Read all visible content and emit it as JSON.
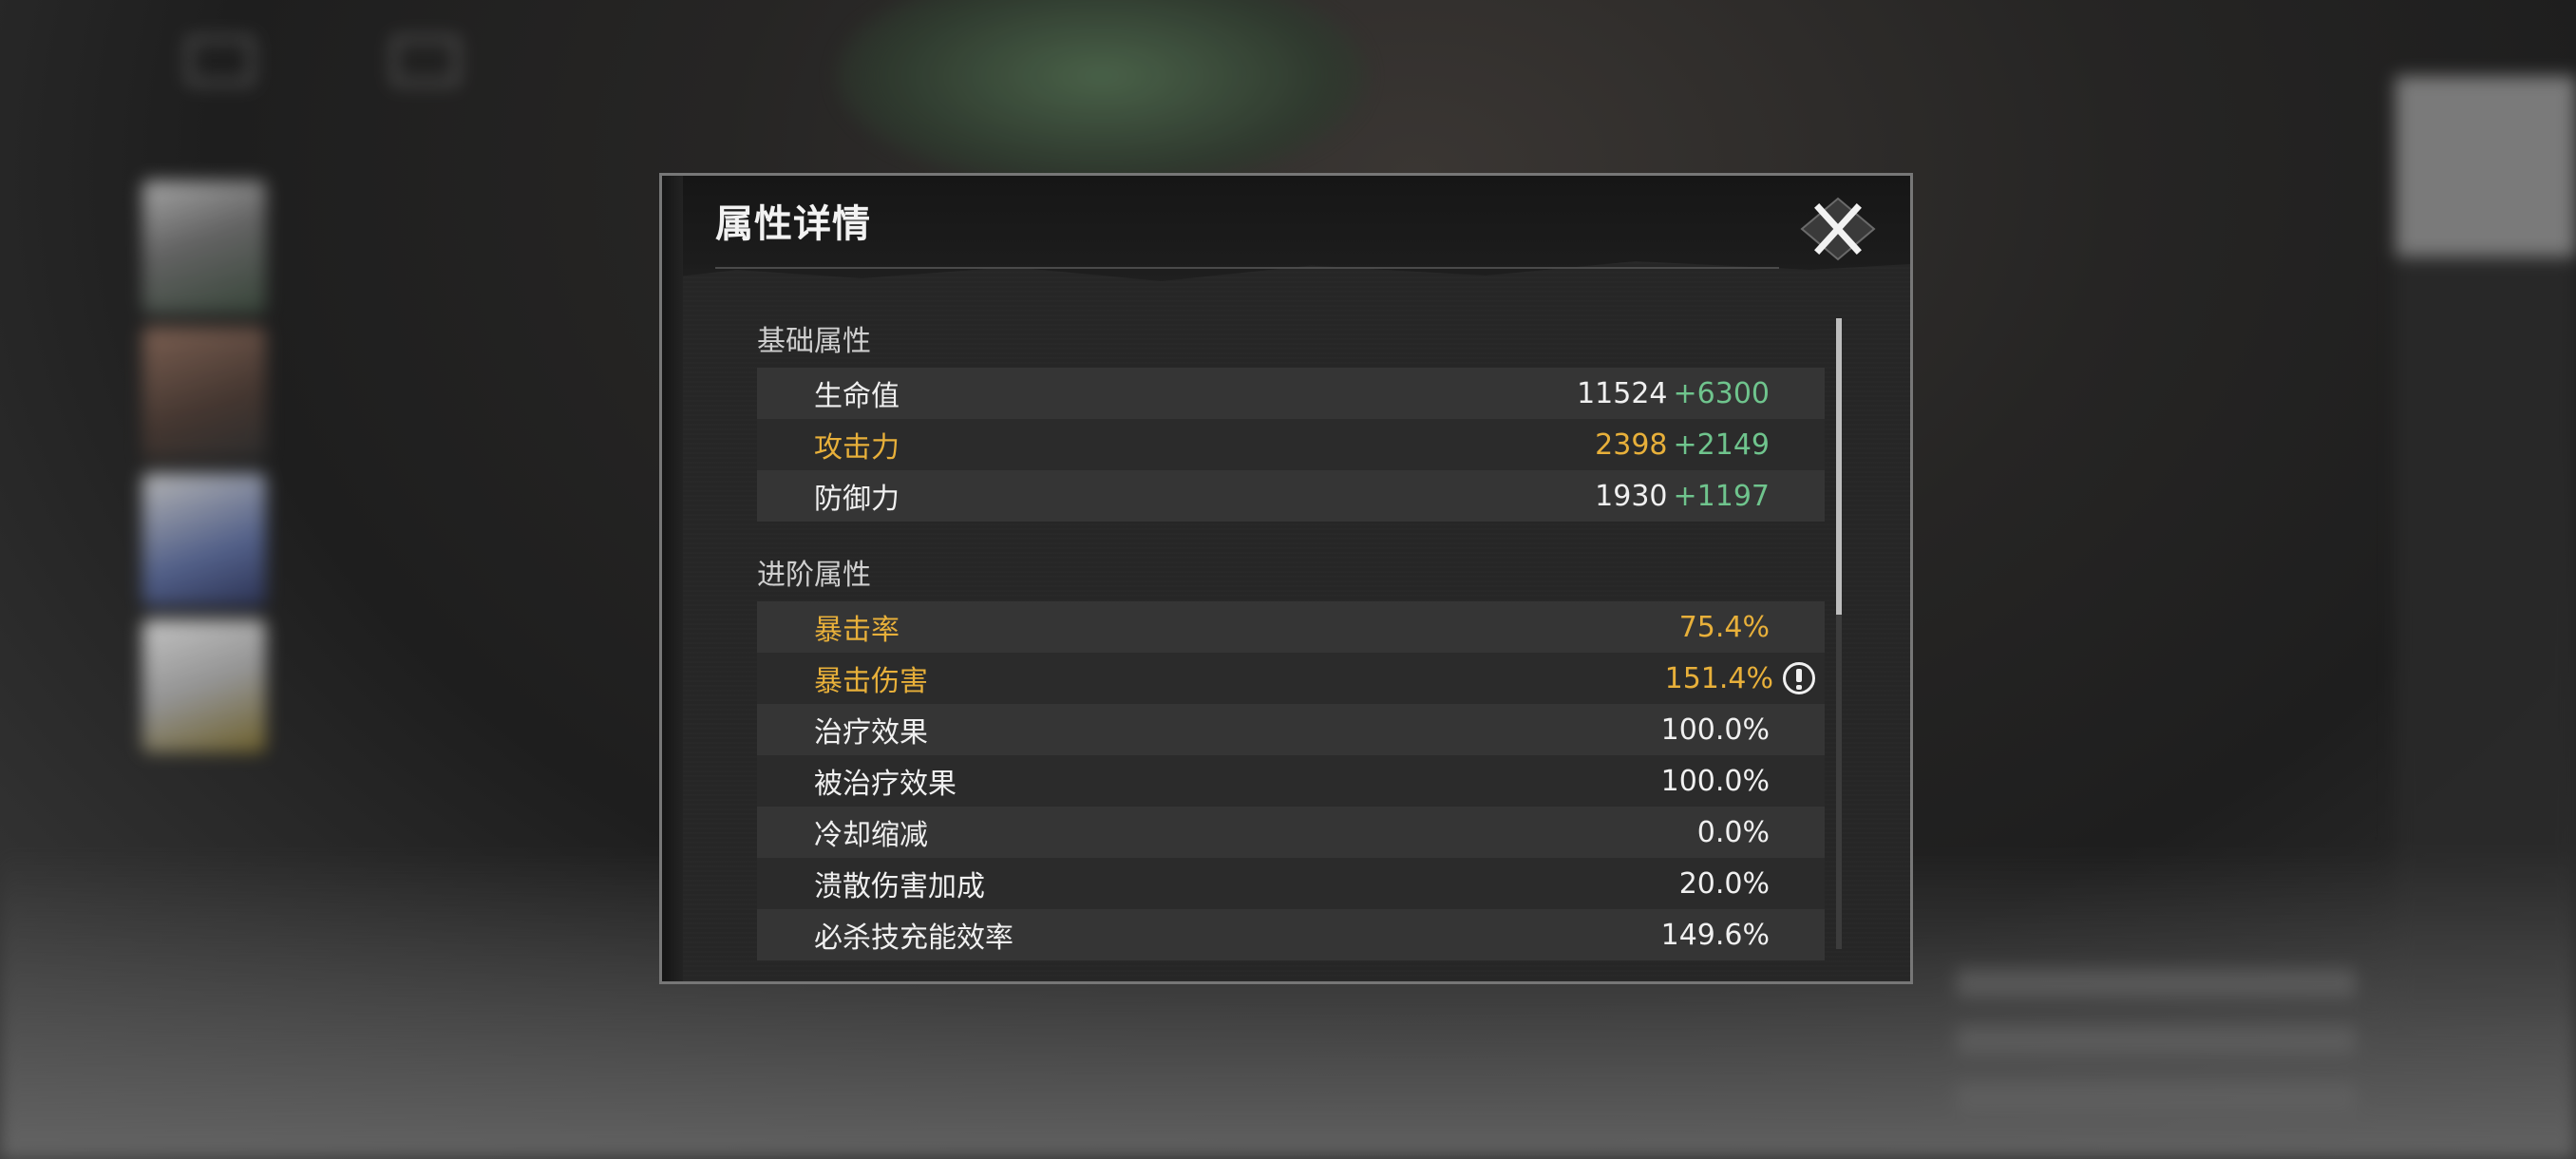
{
  "dialog": {
    "title": "属性详情"
  },
  "sections": {
    "basic": {
      "title": "基础属性",
      "stats": [
        {
          "name": "生命值",
          "base": "11524",
          "bonus": "+6300",
          "highlight": false
        },
        {
          "name": "攻击力",
          "base": "2398",
          "bonus": "+2149",
          "highlight": true
        },
        {
          "name": "防御力",
          "base": "1930",
          "bonus": "+1197",
          "highlight": false
        }
      ]
    },
    "advanced": {
      "title": "进阶属性",
      "stats": [
        {
          "name": "暴击率",
          "base": "75.4%",
          "highlight": true
        },
        {
          "name": "暴击伤害",
          "base": "151.4%",
          "highlight": true,
          "info_icon": "info-icon"
        },
        {
          "name": "治疗效果",
          "base": "100.0%",
          "highlight": false
        },
        {
          "name": "被治疗效果",
          "base": "100.0%",
          "highlight": false
        },
        {
          "name": "冷却缩减",
          "base": "0.0%",
          "highlight": false
        },
        {
          "name": "溃散伤害加成",
          "base": "20.0%",
          "highlight": false
        },
        {
          "name": "必杀技充能效率",
          "base": "149.6%",
          "highlight": false
        }
      ]
    }
  },
  "scroll": {
    "position_fraction": 0.0,
    "visible_fraction": 0.47
  },
  "icons": {
    "close": "close-icon",
    "info": "info-icon"
  },
  "colors": {
    "highlight": "#e8b03a",
    "bonus": "#6fc48d",
    "text": "#f0f0f0",
    "dialog_bg": "#262626"
  }
}
